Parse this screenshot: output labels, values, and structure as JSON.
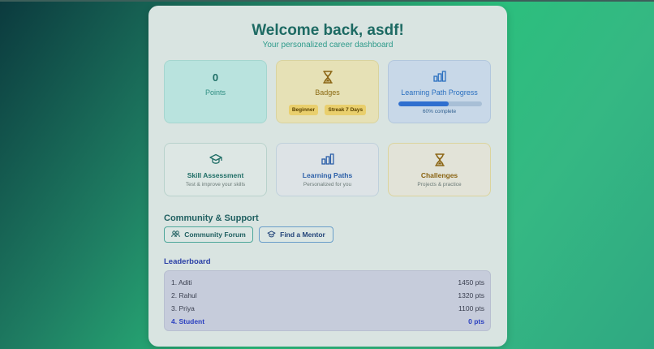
{
  "header": {
    "title": "Welcome back, asdf!",
    "subtitle": "Your personalized career dashboard"
  },
  "stats": {
    "points": {
      "value": "0",
      "label": "Points"
    },
    "badges": {
      "label": "Badges",
      "items": [
        "Beginner",
        "Streak 7 Days"
      ],
      "icon": "hourglass-icon"
    },
    "progress": {
      "label": "Learning Path Progress",
      "caption": "60% complete",
      "percent": 60,
      "icon": "bar-chart-icon"
    }
  },
  "features": [
    {
      "title": "Skill Assessment",
      "subtitle": "Test & improve your skills",
      "icon": "graduation-cap-icon"
    },
    {
      "title": "Learning Paths",
      "subtitle": "Personalized for you",
      "icon": "bar-chart-icon"
    },
    {
      "title": "Challenges",
      "subtitle": "Projects & practice",
      "icon": "hourglass-icon"
    }
  ],
  "community": {
    "heading": "Community & Support",
    "forum_label": "Community Forum",
    "mentor_label": "Find a Mentor"
  },
  "leaderboard": {
    "heading": "Leaderboard",
    "rows": [
      {
        "name": "1. Aditi",
        "score": "1450 pts"
      },
      {
        "name": "2. Rahul",
        "score": "1320 pts"
      },
      {
        "name": "3. Priya",
        "score": "1100 pts"
      },
      {
        "name": "4. Student",
        "score": "0 pts"
      }
    ]
  },
  "colors": {
    "accent_teal": "#1d6a63",
    "accent_blue": "#2f6fcf",
    "accent_gold": "#8a6412",
    "leaderboard_highlight": "#2a3fc0"
  }
}
